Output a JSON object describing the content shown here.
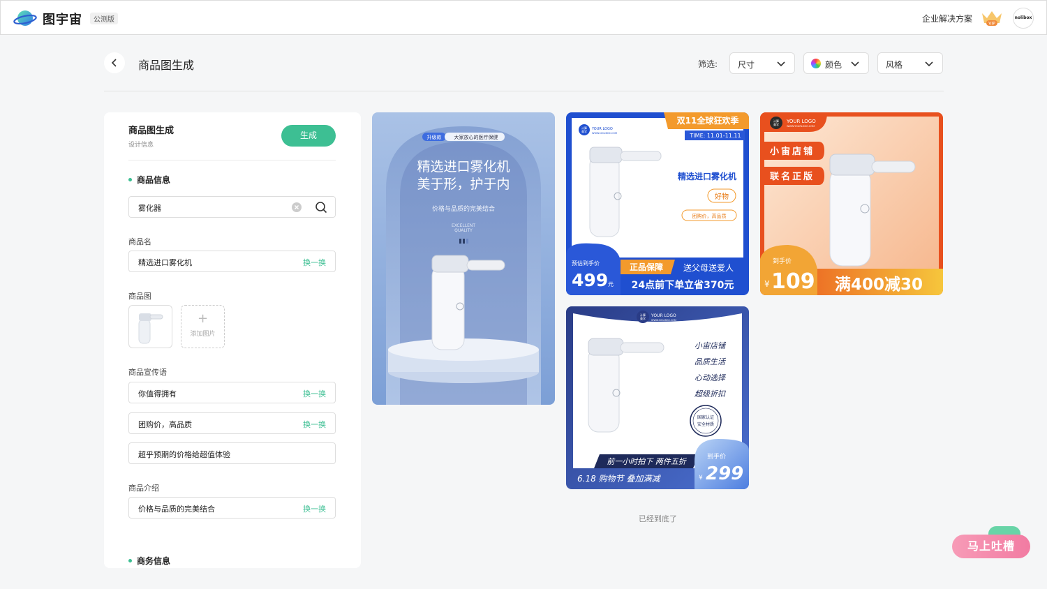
{
  "app": {
    "brand": "图宇宙",
    "beta_badge": "公测版",
    "enterprise_link": "企业解决方案",
    "vip_label": "VIP",
    "avatar_text": "nolibox"
  },
  "header": {
    "title": "商品图生成",
    "filter_label": "筛选:",
    "filters": {
      "size": "尺寸",
      "color": "颜色",
      "style": "风格"
    }
  },
  "panel": {
    "title": "商品图生成",
    "subtitle": "设计信息",
    "generate_label": "生成",
    "product_info_heading": "商品信息",
    "search_value": "雾化器",
    "name_label": "商品名",
    "name_value": "精选进口雾化机",
    "swap_label": "换一换",
    "image_label": "商品图",
    "add_image_label": "添加图片",
    "slogan_label": "商品宣传语",
    "slogans": [
      "你值得拥有",
      "团购价，高品质",
      "超乎预期的价格给超值体验"
    ],
    "intro_label": "商品介绍",
    "intro_value": "价格与品质的完美结合",
    "business_heading": "商务信息"
  },
  "cards": {
    "card1": {
      "badge1": "升级款",
      "badge2": "大家放心的医疗保健",
      "headline1": "精选进口雾化机",
      "headline2": "美于形，护于内",
      "sub": "价格与品质的完美结合",
      "tag1": "EXCELLENT",
      "tag2": "QUALITY"
    },
    "card2": {
      "top_banner": "双11全球狂欢季",
      "time": "TIME: 11.01-11.11",
      "logo_top": "计算",
      "logo_bottom": "美学",
      "logo_name": "YOUR LOGO",
      "logo_url": "WWW.NOLIBOX.COM",
      "headline": "精选进口雾化机",
      "pill": "好物",
      "pill2": "团购价，高品质",
      "price_label": "预估到手价",
      "price": "499",
      "price_unit": "元",
      "band1": "正品保障",
      "band2": "送父母送爱人",
      "band3": "24点前下单立省370元"
    },
    "card3": {
      "logo_top": "计算",
      "logo_bottom": "美学",
      "logo_name": "YOUR LOGO",
      "logo_url": "WWW.YOURLOGO.COM",
      "tag1": "小宙店铺",
      "tag2": "联名正版",
      "price_label": "到手价",
      "currency": "¥",
      "price": "109",
      "promo": "满400减30"
    },
    "card4": {
      "logo_top": "计算",
      "logo_bottom": "美学",
      "logo_name": "YOUR LOGO",
      "logo_url": "WWW.NOLIBOX.COM",
      "lines": [
        "小宙店铺",
        "品质生活",
        "心动选择",
        "超级折扣"
      ],
      "seal1": "国家认证",
      "seal2": "安全材质",
      "band1": "前一小时拍下 两件五折",
      "band2": "6.18 购物节  叠加满减",
      "price_label": "到手价",
      "currency": "¥",
      "price": "299"
    }
  },
  "footer_note": "已经到底了",
  "feedback_label": "马上吐槽",
  "colors": {
    "accent": "#3dbf93",
    "card2_blue": "#1f4fd0",
    "card3_orange": "#e8501e",
    "card4_navy": "#2a3c86"
  }
}
